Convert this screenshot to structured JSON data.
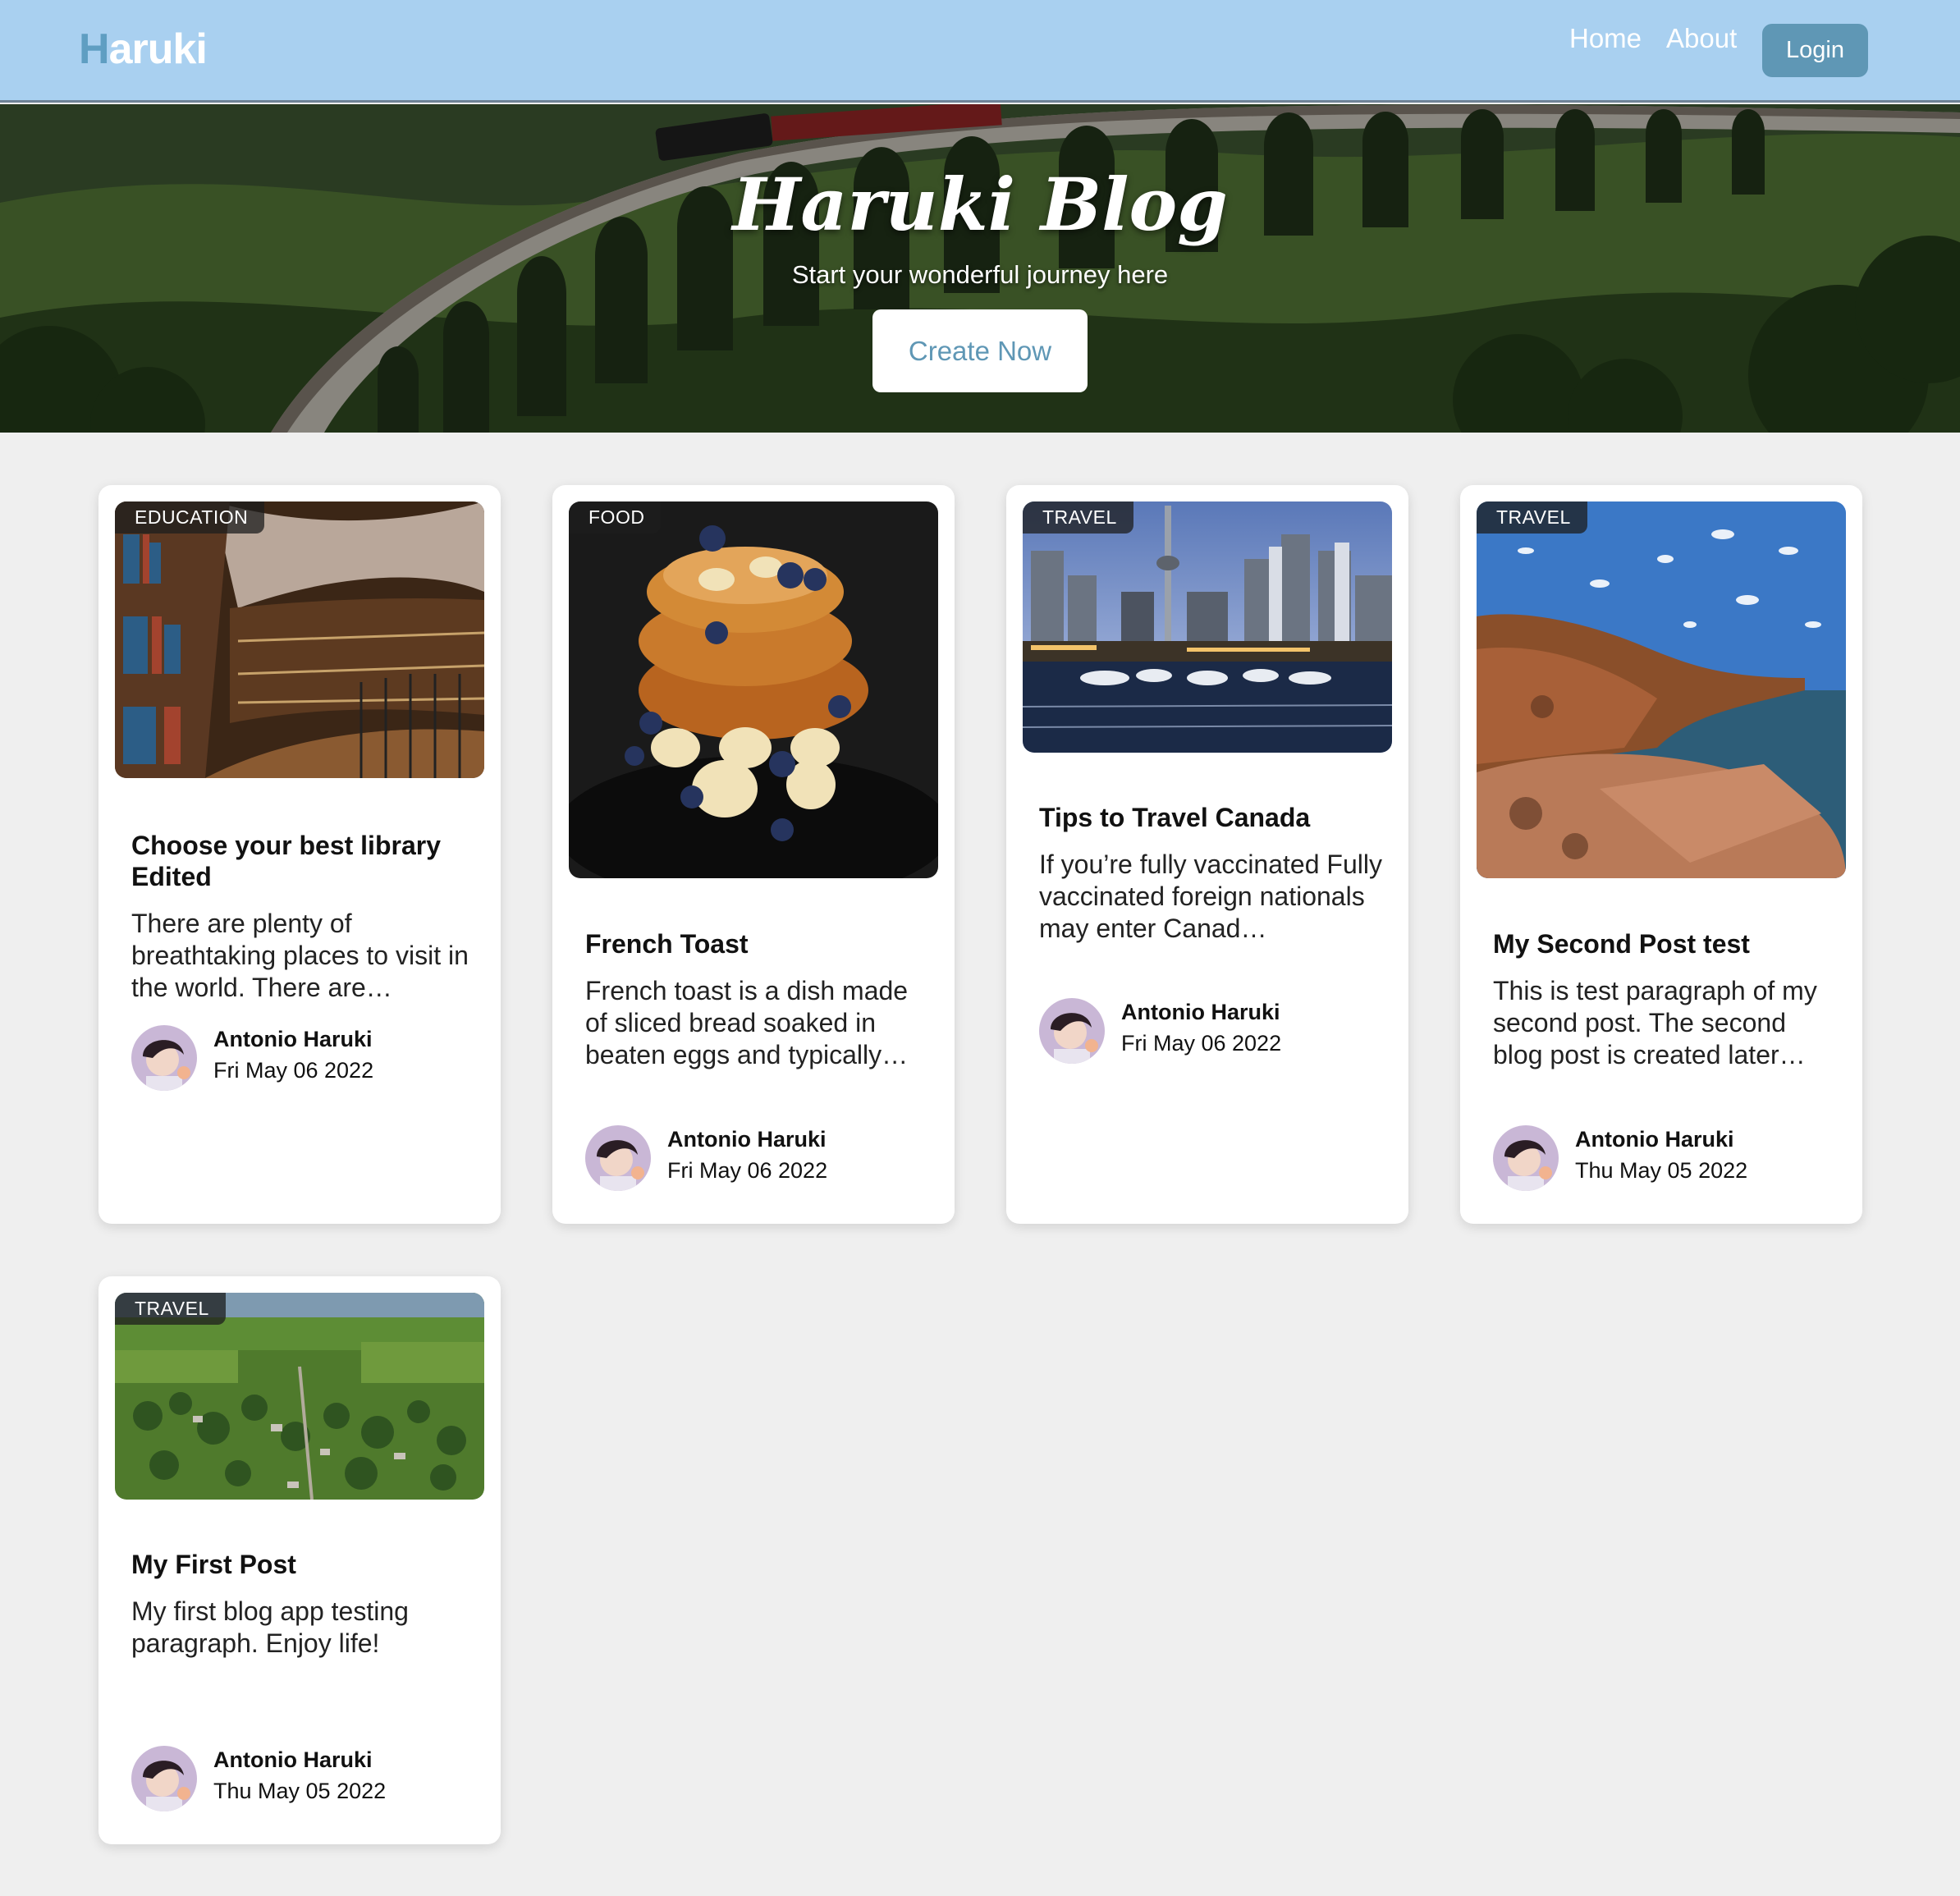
{
  "header": {
    "logo_first": "H",
    "logo_rest": "aruki",
    "nav": {
      "home": "Home",
      "about": "About"
    },
    "login_label": "Login"
  },
  "hero": {
    "title": "Haruki Blog",
    "subtitle": "Start your wonderful journey here",
    "cta_label": "Create Now"
  },
  "posts": [
    {
      "category": "EDUCATION",
      "title": "Choose your best library Edited",
      "excerpt": "There are plenty of breathtaking places to visit in the world. There are…",
      "author": "Antonio Haruki",
      "date": "Fri May 06 2022"
    },
    {
      "category": "FOOD",
      "title": "French Toast",
      "excerpt": "French toast is a dish made of sliced bread soaked in beaten eggs and typically…",
      "author": "Antonio Haruki",
      "date": "Fri May 06 2022"
    },
    {
      "category": "TRAVEL",
      "title": "Tips to Travel Canada",
      "excerpt": "If you’re fully vaccinated Fully vaccinated foreign nationals may enter Canad…",
      "author": "Antonio Haruki",
      "date": "Fri May 06 2022"
    },
    {
      "category": "TRAVEL",
      "title": "My Second Post test",
      "excerpt": "This is test paragraph of my second post. The second blog post is created later…",
      "author": "Antonio Haruki",
      "date": "Thu May 05 2022"
    },
    {
      "category": "TRAVEL",
      "title": "My First Post",
      "excerpt": "My first blog app testing paragraph. Enjoy life!",
      "author": "Antonio Haruki",
      "date": "Thu May 05 2022"
    }
  ],
  "colors": {
    "header_bg": "#a9d0f0",
    "accent": "#5f97b5",
    "page_bg": "#efefef"
  }
}
